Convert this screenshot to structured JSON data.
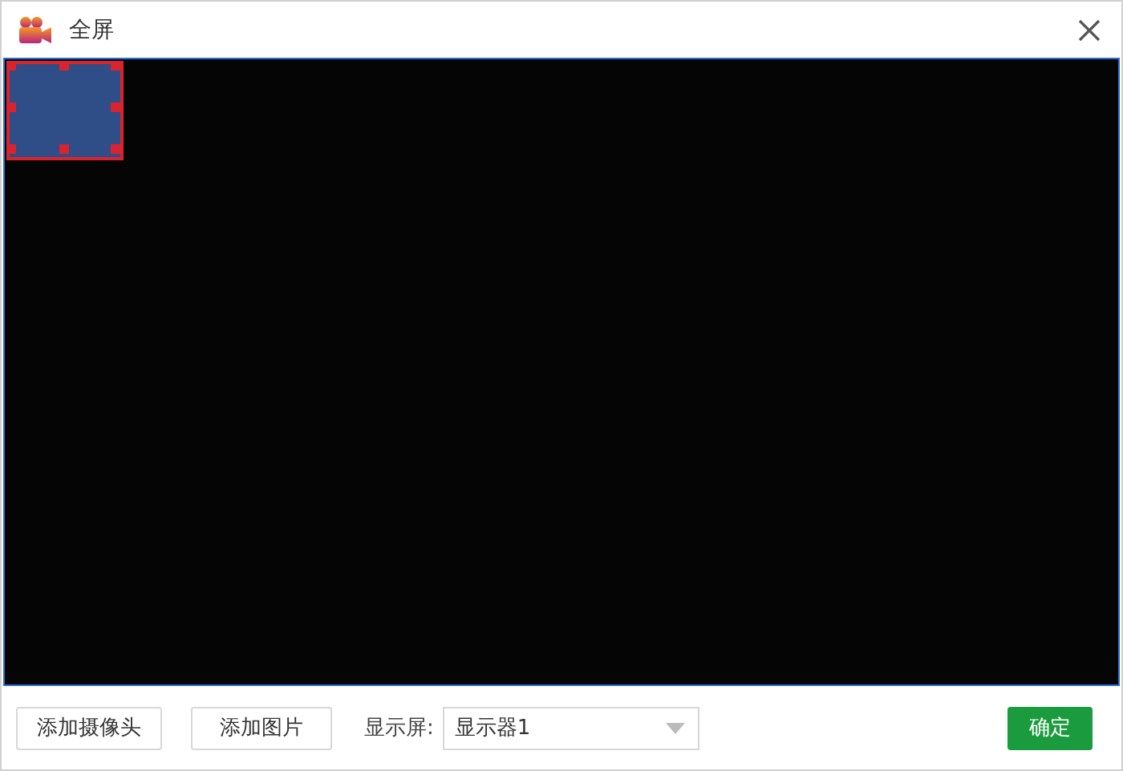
{
  "window": {
    "title": "全屏"
  },
  "footer": {
    "buttons": [
      {
        "label": "添加摄像头"
      },
      {
        "label": "添加图片"
      }
    ],
    "display_label": "显示屏:",
    "display_select": {
      "value": "显示器1"
    },
    "confirm": {
      "label": "确定"
    }
  }
}
